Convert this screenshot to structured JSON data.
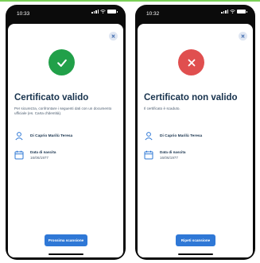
{
  "screens": [
    {
      "status_time": "10:33",
      "status": "valid",
      "status_color": "#21a049",
      "status_icon": "check-icon",
      "title": "Certificato valido",
      "subtitle": "Per sicurezza, confrontare i seguenti dati con un documento ufficiale (es. Carta d'identità).",
      "person_name": "Di Caprio Marilù Teresa",
      "birth_label": "Data di nascita",
      "birth_value": "16/06/1977",
      "button_label": "Prossima scansione"
    },
    {
      "status_time": "10:32",
      "status": "invalid",
      "status_color": "#e04f4f",
      "status_icon": "cross-icon",
      "title": "Certificato non valido",
      "subtitle": "Il certificato è scaduto.",
      "person_name": "Di Caprio Marilù Teresa",
      "birth_label": "Data di nascita",
      "birth_value": "16/06/1977",
      "button_label": "Ripeti scansione"
    }
  ],
  "colors": {
    "accent": "#2f78d6",
    "title": "#17324d",
    "valid": "#21a049",
    "invalid": "#e04f4f"
  }
}
